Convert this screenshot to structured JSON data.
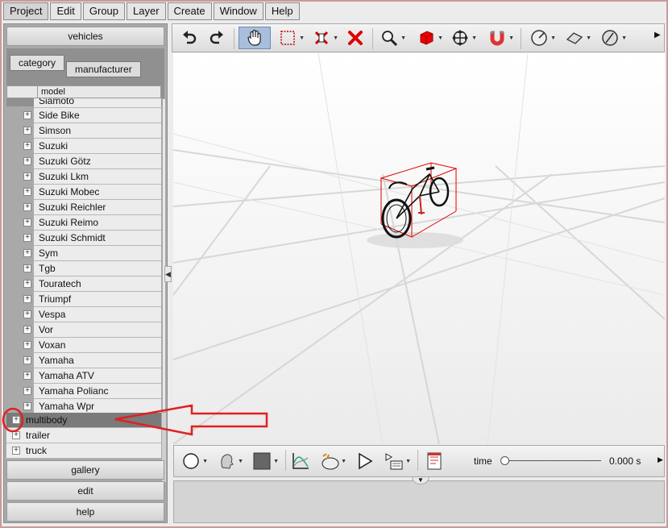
{
  "menu": [
    "Project",
    "Edit",
    "Group",
    "Layer",
    "Create",
    "Window",
    "Help"
  ],
  "left_panel": {
    "top_button": "vehicles",
    "tabs": [
      "category",
      "manufacturer"
    ],
    "column_header": "model",
    "manufacturers": [
      "Siamoto",
      "Side Bike",
      "Simson",
      "Suzuki",
      "Suzuki Götz",
      "Suzuki Lkm",
      "Suzuki Mobec",
      "Suzuki Reichler",
      "Suzuki Reimo",
      "Suzuki Schmidt",
      "Sym",
      "Tgb",
      "Touratech",
      "Triumpf",
      "Vespa",
      "Vor",
      "Voxan",
      "Yamaha",
      "Yamaha ATV",
      "Yamaha Polianc",
      "Yamaha Wpr"
    ],
    "categories": [
      "multibody",
      "trailer",
      "truck"
    ],
    "bottom_buttons": [
      "gallery",
      "edit",
      "help"
    ]
  },
  "toolbar_icons": [
    "undo-icon",
    "redo-icon",
    "hand-icon",
    "selection-box-icon",
    "erase-icon",
    "delete-icon",
    "zoom-icon",
    "cube-icon",
    "move-icon",
    "magnet-icon",
    "measure-icon",
    "plane-icon",
    "angle-icon"
  ],
  "bottom_toolbar": {
    "icons": [
      "circle-icon",
      "head-icon",
      "color-square-icon",
      "graph-icon",
      "camera-icon",
      "play-icon",
      "render-icon",
      "notes-icon"
    ],
    "time_label": "time",
    "time_value": "0.000 s",
    "time_position": 0
  },
  "colors": {
    "annotation": "#e02020",
    "selection_box": "#e00000",
    "pressed_button": "#a9bedc"
  }
}
